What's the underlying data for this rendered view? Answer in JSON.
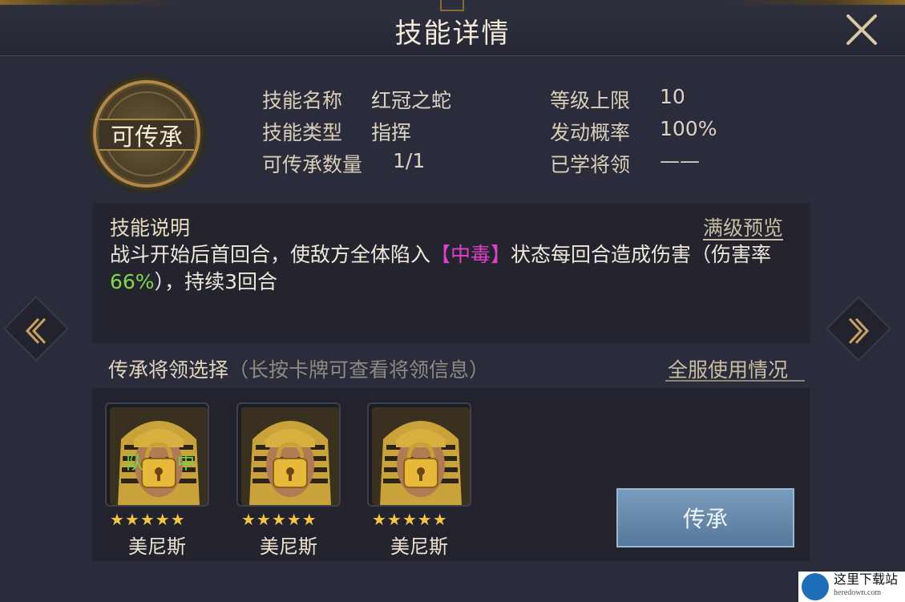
{
  "header": {
    "title": "技能详情"
  },
  "emblem": {
    "label": "可传承"
  },
  "info": {
    "skill_name_label": "技能名称",
    "skill_name": "红冠之蛇",
    "skill_type_label": "技能类型",
    "skill_type": "指挥",
    "inherit_count_label": "可传承数量",
    "inherit_count": "1/1",
    "level_cap_label": "等级上限",
    "level_cap": "10",
    "trigger_rate_label": "发动概率",
    "trigger_rate": "100%",
    "learned_general_label": "已学将领",
    "learned_general": "——"
  },
  "description": {
    "title": "技能说明",
    "preview_link": "满级预览",
    "text_part1": "战斗开始后首回合，使敌方全体陷入",
    "status": "【中毒】",
    "text_part2": "状态每回合造成伤害（伤害率",
    "rate": "66%",
    "text_part3": "），持续3回合"
  },
  "inherit": {
    "title": "传承将领选择",
    "hint": "（长按卡牌可查看将领信息）",
    "server_link": "全服使用情况",
    "button_label": "传承"
  },
  "cards": [
    {
      "name": "美尼斯",
      "stars": 5,
      "tag_left": "队",
      "tag_right": "中"
    },
    {
      "name": "美尼斯",
      "stars": 5
    },
    {
      "name": "美尼斯",
      "stars": 5
    }
  ],
  "watermark": {
    "text": "这里下载站",
    "sub": "heredown.com"
  },
  "colors": {
    "accent_gold": "#b08a45",
    "poison": "#e040c8",
    "rate_green": "#7fd94a",
    "button_blue": "#6a8cae"
  }
}
